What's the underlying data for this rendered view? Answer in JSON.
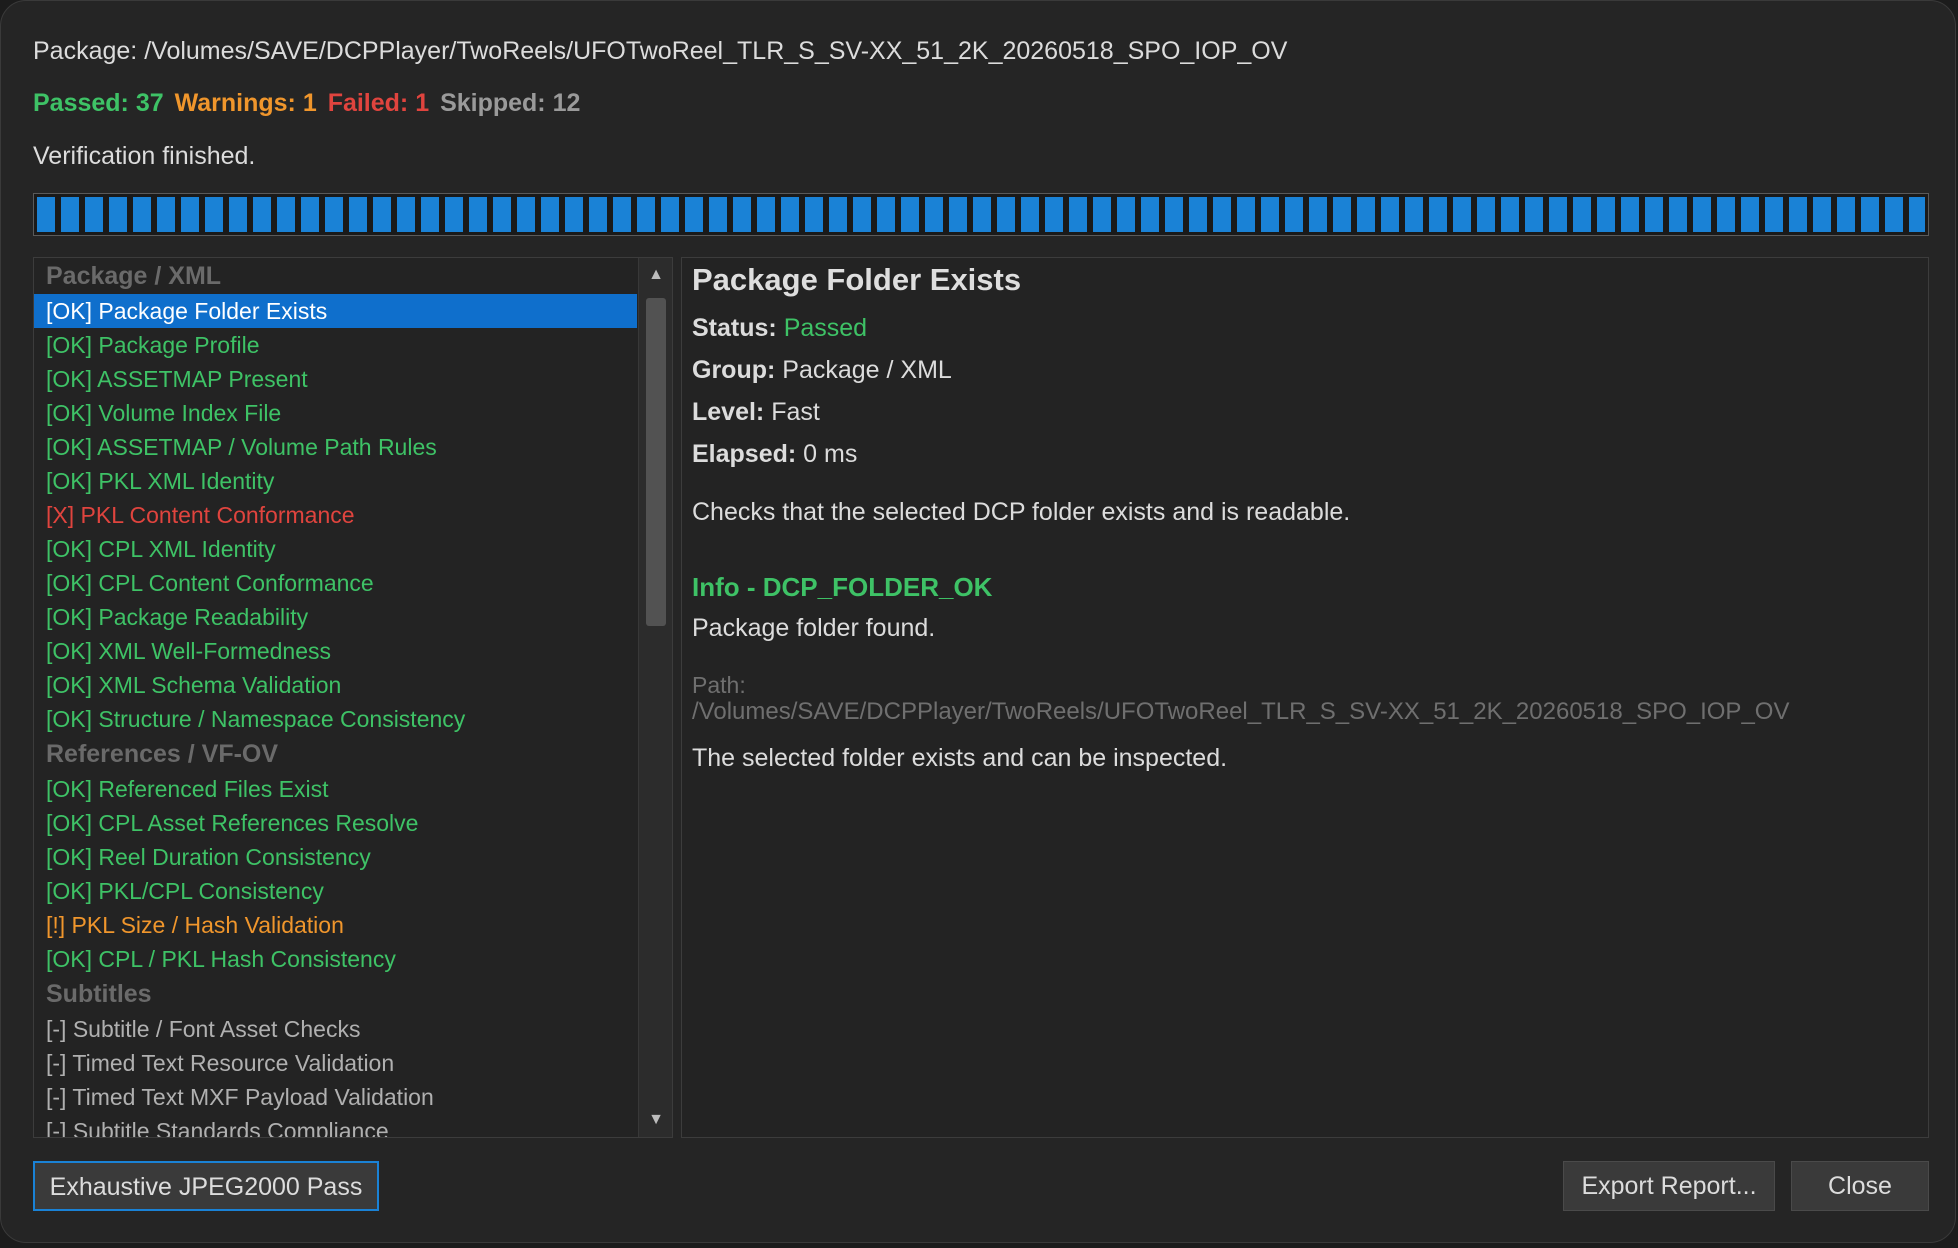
{
  "header": {
    "package_label": "Package:",
    "package_path": "/Volumes/SAVE/DCPPlayer/TwoReels/UFOTwoReel_TLR_S_SV-XX_51_2K_20260518_SPO_IOP_OV",
    "passed": "Passed: 37",
    "warnings": "Warnings: 1",
    "failed": "Failed: 1",
    "skipped": "Skipped: 12",
    "status_text": "Verification finished."
  },
  "progress": {
    "fraction": 1.0
  },
  "checks": [
    {
      "type": "group",
      "label": "Package / XML"
    },
    {
      "type": "ok",
      "label": "[OK] Package Folder Exists",
      "selected": true
    },
    {
      "type": "ok",
      "label": "[OK] Package Profile"
    },
    {
      "type": "ok",
      "label": "[OK] ASSETMAP Present"
    },
    {
      "type": "ok",
      "label": "[OK] Volume Index File"
    },
    {
      "type": "ok",
      "label": "[OK] ASSETMAP / Volume Path Rules"
    },
    {
      "type": "ok",
      "label": "[OK] PKL XML Identity"
    },
    {
      "type": "fail",
      "label": "[X] PKL Content Conformance"
    },
    {
      "type": "ok",
      "label": "[OK] CPL XML Identity"
    },
    {
      "type": "ok",
      "label": "[OK] CPL Content Conformance"
    },
    {
      "type": "ok",
      "label": "[OK] Package Readability"
    },
    {
      "type": "ok",
      "label": "[OK] XML Well-Formedness"
    },
    {
      "type": "ok",
      "label": "[OK] XML Schema Validation"
    },
    {
      "type": "ok",
      "label": "[OK] Structure / Namespace Consistency"
    },
    {
      "type": "group",
      "label": "References / VF-OV"
    },
    {
      "type": "ok",
      "label": "[OK] Referenced Files Exist"
    },
    {
      "type": "ok",
      "label": "[OK] CPL Asset References Resolve"
    },
    {
      "type": "ok",
      "label": "[OK] Reel Duration Consistency"
    },
    {
      "type": "ok",
      "label": "[OK] PKL/CPL Consistency"
    },
    {
      "type": "warn",
      "label": "[!] PKL Size / Hash Validation"
    },
    {
      "type": "ok",
      "label": "[OK] CPL / PKL Hash Consistency"
    },
    {
      "type": "group",
      "label": "Subtitles"
    },
    {
      "type": "skip",
      "label": "[-] Subtitle / Font Asset Checks"
    },
    {
      "type": "skip",
      "label": "[-] Timed Text Resource Validation"
    },
    {
      "type": "skip",
      "label": "[-] Timed Text MXF Payload Validation"
    },
    {
      "type": "skip",
      "label": "[-] Subtitle Standards Compliance"
    }
  ],
  "detail": {
    "title": "Package Folder Exists",
    "status_label": "Status:",
    "status_value": "Passed",
    "group_label": "Group:",
    "group_value": "Package / XML",
    "level_label": "Level:",
    "level_value": "Fast",
    "elapsed_label": "Elapsed:",
    "elapsed_value": "0 ms",
    "description": "Checks that the selected DCP folder exists and is readable.",
    "info_title": "Info - DCP_FOLDER_OK",
    "info_message": "Package folder found.",
    "path_label": "Path:",
    "path_value": "/Volumes/SAVE/DCPPlayer/TwoReels/UFOTwoReel_TLR_S_SV-XX_51_2K_20260518_SPO_IOP_OV",
    "conclusion": "The selected folder exists and can be inspected."
  },
  "buttons": {
    "exhaustive": "Exhaustive JPEG2000 Pass",
    "export": "Export Report...",
    "close": "Close"
  },
  "colors": {
    "passed": "#3ec266",
    "warning": "#f0962c",
    "failed": "#e0443e",
    "skipped": "#9a9a9a",
    "accent": "#1a82d6"
  }
}
